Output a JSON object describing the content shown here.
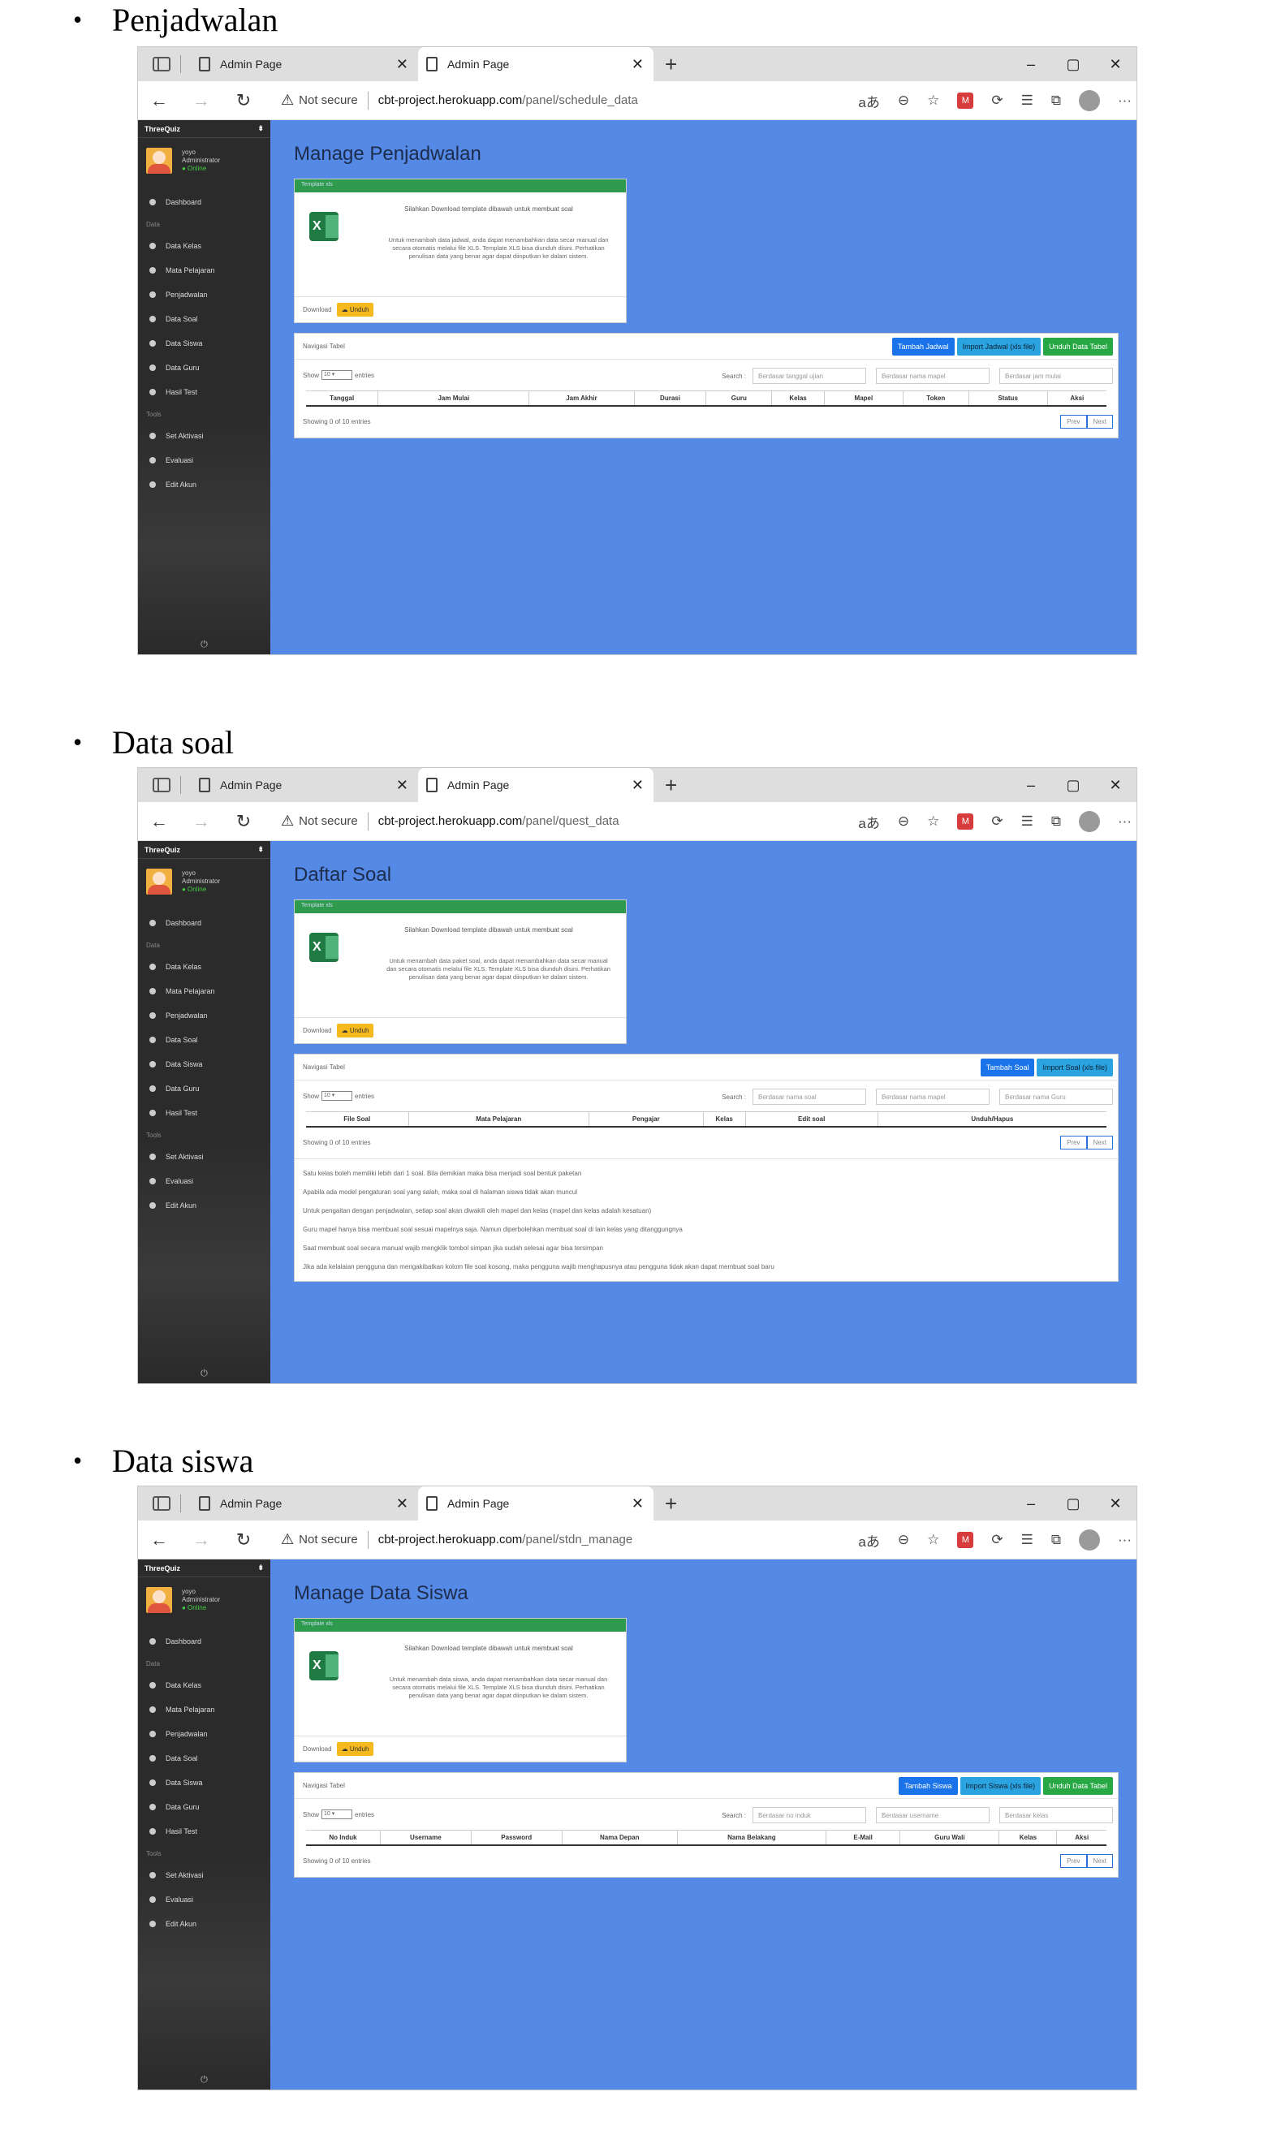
{
  "sections": [
    {
      "heading": "Penjadwalan",
      "tab_label": "Admin Page",
      "url_host": "cbt-project.herokuapp.com",
      "url_path": "/panel/schedule_data",
      "page_title": "Manage Penjadwalan",
      "template_text": "Silahkan Download template dibawah untuk membuat soal",
      "template_desc": "Untuk menambah data jadwal, anda dapat menambahkan data secar manual dan secara otomatis melalui file XLS. Template XLS bisa diunduh disini. Perhatikan penulisan data yang benar agar dapat diinputkan ke dalam sistem.",
      "buttons": [
        {
          "label": "Tambah Jadwal",
          "color": "blue"
        },
        {
          "label": "Import Jadwal (xls file)",
          "color": "lblue"
        },
        {
          "label": "Unduh Data Tabel",
          "color": "green"
        }
      ],
      "search_placeholders": [
        "Berdasar tanggal ujian",
        "Berdasar nama mapel",
        "Berdasar jam mulai"
      ],
      "columns": [
        "Tanggal",
        "Jam Mulai",
        "Jam Akhir",
        "Durasi",
        "Guru",
        "Kelas",
        "Mapel",
        "Token",
        "Status",
        "Aksi"
      ],
      "notes": []
    },
    {
      "heading": "Data soal",
      "tab_label": "Admin Page",
      "url_host": "cbt-project.herokuapp.com",
      "url_path": "/panel/quest_data",
      "page_title": "Daftar Soal",
      "template_text": "Silahkan Download template dibawah untuk membuat soal",
      "template_desc": "Untuk menambah data paket soal, anda dapat menambahkan data secar manual dan secara otomatis melalui file XLS. Template XLS bisa diunduh disini. Perhatikan penulisan data yang benar agar dapat diinputkan ke dalam sistem.",
      "buttons": [
        {
          "label": "Tambah Soal",
          "color": "blue"
        },
        {
          "label": "Import Soal (xls file)",
          "color": "lblue"
        }
      ],
      "search_placeholders": [
        "Berdasar nama soal",
        "Berdasar nama mapel",
        "Berdasar nama Guru"
      ],
      "columns": [
        "File Soal",
        "Mata Pelajaran",
        "Pengajar",
        "Kelas",
        "Edit soal",
        "Unduh/Hapus"
      ],
      "notes": [
        "Satu kelas boleh memiliki lebih dari 1 soal. Bila demikian maka bisa menjadi soal bentuk paketan",
        "Apabila ada model pengaturan soal yang salah, maka soal di halaman siswa tidak akan muncul",
        "Untuk pengaitan dengan penjadwalan, setiap soal akan diwakili oleh mapel dan kelas (mapel dan kelas adalah kesatuan)",
        "Guru mapel hanya bisa membuat soal sesuai mapelnya saja. Namun diperbolehkan membuat soal di lain kelas yang ditanggungnya",
        "Saat membuat soal secara manual wajib mengklik tombol simpan jika sudah selesai agar bisa tersimpan",
        "Jika ada kelalaian pengguna dan mengakibatkan kolom file soal kosong, maka pengguna wajib menghapusnya atau pengguna tidak akan dapat membuat soal baru"
      ]
    },
    {
      "heading": "Data siswa",
      "tab_label": "Admin Page",
      "url_host": "cbt-project.herokuapp.com",
      "url_path": "/panel/stdn_manage",
      "page_title": "Manage Data Siswa",
      "template_text": "Silahkan Download template dibawah untuk membuat soal",
      "template_desc": "Untuk menambah data siswa, anda dapat menambahkan data secar manual dan secara otomatis melalui file XLS. Template XLS bisa diunduh disini. Perhatikan penulisan data yang benar agar dapat diinputkan ke dalam sistem.",
      "buttons": [
        {
          "label": "Tambah Siswa",
          "color": "blue"
        },
        {
          "label": "Import Siswa (xls file)",
          "color": "lblue"
        },
        {
          "label": "Unduh Data Tabel",
          "color": "green"
        }
      ],
      "search_placeholders": [
        "Berdasar no induk",
        "Berdasar username",
        "Berdasar kelas"
      ],
      "columns": [
        "No Induk",
        "Username",
        "Password",
        "Nama Depan",
        "Nama Belakang",
        "E-Mail",
        "Guru Wali",
        "Kelas",
        "Aksi"
      ],
      "notes": []
    }
  ],
  "common": {
    "not_secure": "Not secure",
    "brand": "ThreeQuiz",
    "user_name": "yoyo",
    "user_role": "Administrator",
    "user_status": "● Online",
    "menu": [
      {
        "label": "Dashboard",
        "type": "item"
      },
      {
        "label": "Data",
        "type": "section"
      },
      {
        "label": "Data Kelas",
        "type": "item"
      },
      {
        "label": "Mata Pelajaran",
        "type": "item"
      },
      {
        "label": "Penjadwalan",
        "type": "item"
      },
      {
        "label": "Data Soal",
        "type": "item"
      },
      {
        "label": "Data Siswa",
        "type": "item"
      },
      {
        "label": "Data Guru",
        "type": "item"
      },
      {
        "label": "Hasil Test",
        "type": "item"
      },
      {
        "label": "Tools",
        "type": "section"
      },
      {
        "label": "Set Aktivasi",
        "type": "item"
      },
      {
        "label": "Evaluasi",
        "type": "item"
      },
      {
        "label": "Edit Akun",
        "type": "item"
      }
    ],
    "template_header": "Template xls",
    "download_label": "Download",
    "unduh_label": "Unduh",
    "nav_label": "Navigasi Tabel",
    "show_label": "Show",
    "show_value": "10",
    "entries_label": "entries",
    "search_label": "Search :",
    "showing_text": "Showing 0 of 10 entries",
    "prev": "Prev",
    "next": "Next",
    "bullet": "•"
  }
}
